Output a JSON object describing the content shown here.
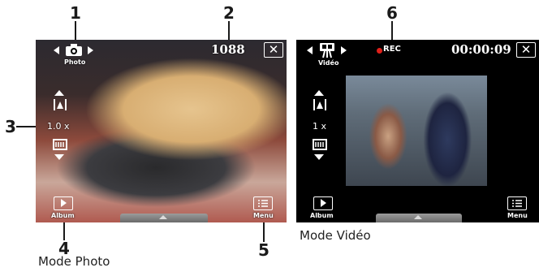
{
  "callouts": {
    "c1": "1",
    "c2": "2",
    "c3": "3",
    "c4": "4",
    "c5": "5",
    "c6": "6"
  },
  "photo_screen": {
    "mode_label": "Photo",
    "shots_remaining": "1088",
    "zoom_level": "1.0 x",
    "album_label": "Album",
    "menu_label": "Menu",
    "caption": "Mode Photo"
  },
  "video_screen": {
    "mode_label": "Vidéo",
    "rec_label": "REC",
    "timer": "00:00:09",
    "zoom_level": "1 x",
    "album_label": "Album",
    "menu_label": "Menu",
    "caption": "Mode Vidéo"
  },
  "colors": {
    "rec_dot": "#e0201a",
    "screen_bg": "#000000",
    "ui_white": "#ffffff"
  }
}
